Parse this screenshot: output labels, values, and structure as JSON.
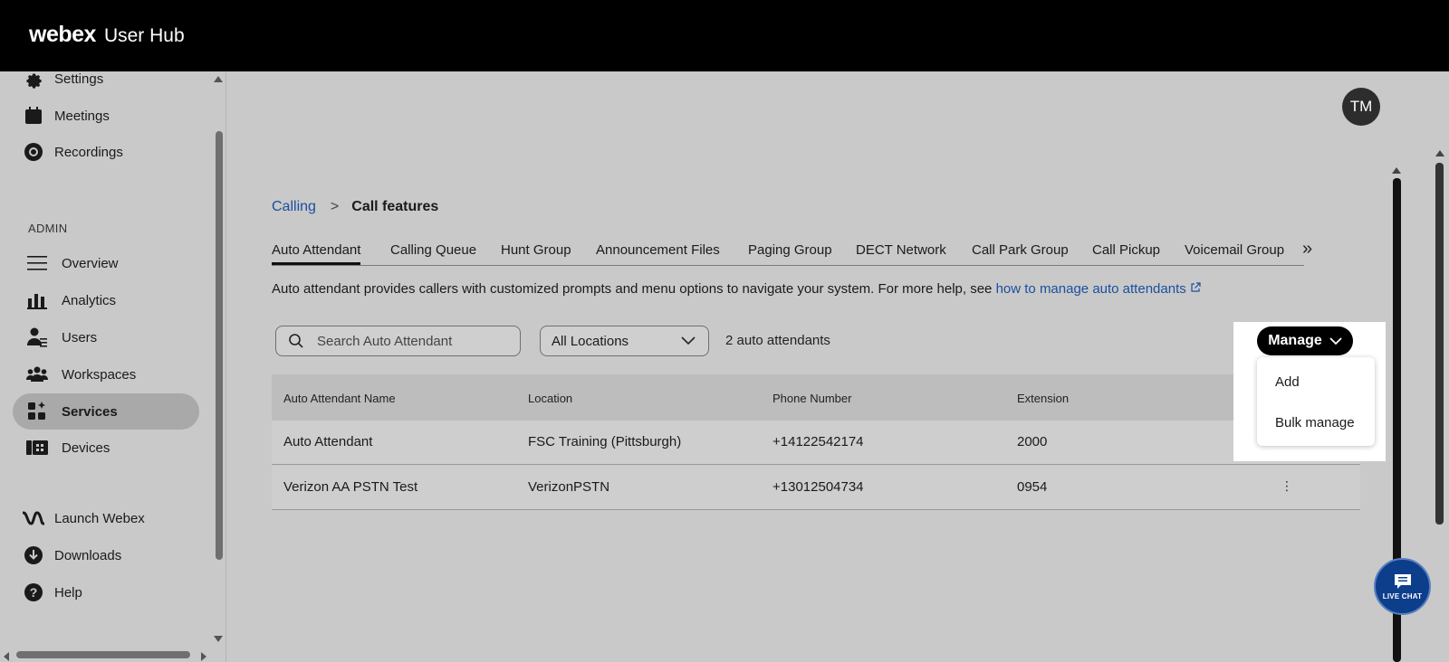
{
  "app": {
    "brand": "webex",
    "subtitle": "User Hub"
  },
  "user": {
    "initials": "TM"
  },
  "sidebar": {
    "top_items": [
      {
        "label": "Settings",
        "icon": "gear-icon"
      },
      {
        "label": "Meetings",
        "icon": "calendar-icon"
      },
      {
        "label": "Recordings",
        "icon": "record-icon"
      }
    ],
    "admin_label": "ADMIN",
    "admin_items": [
      {
        "label": "Overview",
        "icon": "menu-lines-icon"
      },
      {
        "label": "Analytics",
        "icon": "bar-chart-icon"
      },
      {
        "label": "Users",
        "icon": "user-list-icon"
      },
      {
        "label": "Workspaces",
        "icon": "group-icon"
      },
      {
        "label": "Services",
        "icon": "grid-apps-icon",
        "active": true
      },
      {
        "label": "Devices",
        "icon": "devices-icon"
      }
    ],
    "bottom_items": [
      {
        "label": "Launch Webex",
        "icon": "webex-logo-icon"
      },
      {
        "label": "Downloads",
        "icon": "download-icon"
      },
      {
        "label": "Help",
        "icon": "help-icon"
      }
    ]
  },
  "breadcrumb": {
    "parent": "Calling",
    "separator": ">",
    "current": "Call features"
  },
  "tabs": [
    "Auto Attendant",
    "Calling Queue",
    "Hunt Group",
    "Announcement Files",
    "Paging Group",
    "DECT Network",
    "Call Park Group",
    "Call Pickup",
    "Voicemail Group"
  ],
  "tabs_more": "»",
  "description": {
    "text": "Auto attendant provides callers with customized prompts and menu options to navigate your system. For more help, see ",
    "link": "how to manage auto attendants"
  },
  "filters": {
    "search_placeholder": "Search Auto Attendant",
    "location_selected": "All Locations",
    "count_text": "2 auto attendants"
  },
  "manage": {
    "label": "Manage",
    "menu": [
      "Add",
      "Bulk manage"
    ]
  },
  "table": {
    "columns": [
      "Auto Attendant Name",
      "Location",
      "Phone Number",
      "Extension"
    ],
    "rows": [
      [
        "Auto Attendant",
        "FSC Training (Pittsburgh)",
        "+14122542174",
        "2000"
      ],
      [
        "Verizon AA PSTN Test",
        "VerizonPSTN",
        "+13012504734",
        "0954"
      ]
    ],
    "row_menu": "⋮"
  },
  "live_chat": {
    "label": "LIVE CHAT"
  },
  "colors": {
    "link": "#1b4fa0",
    "topbar": "#000000",
    "live_chat": "#0d3e8c"
  }
}
